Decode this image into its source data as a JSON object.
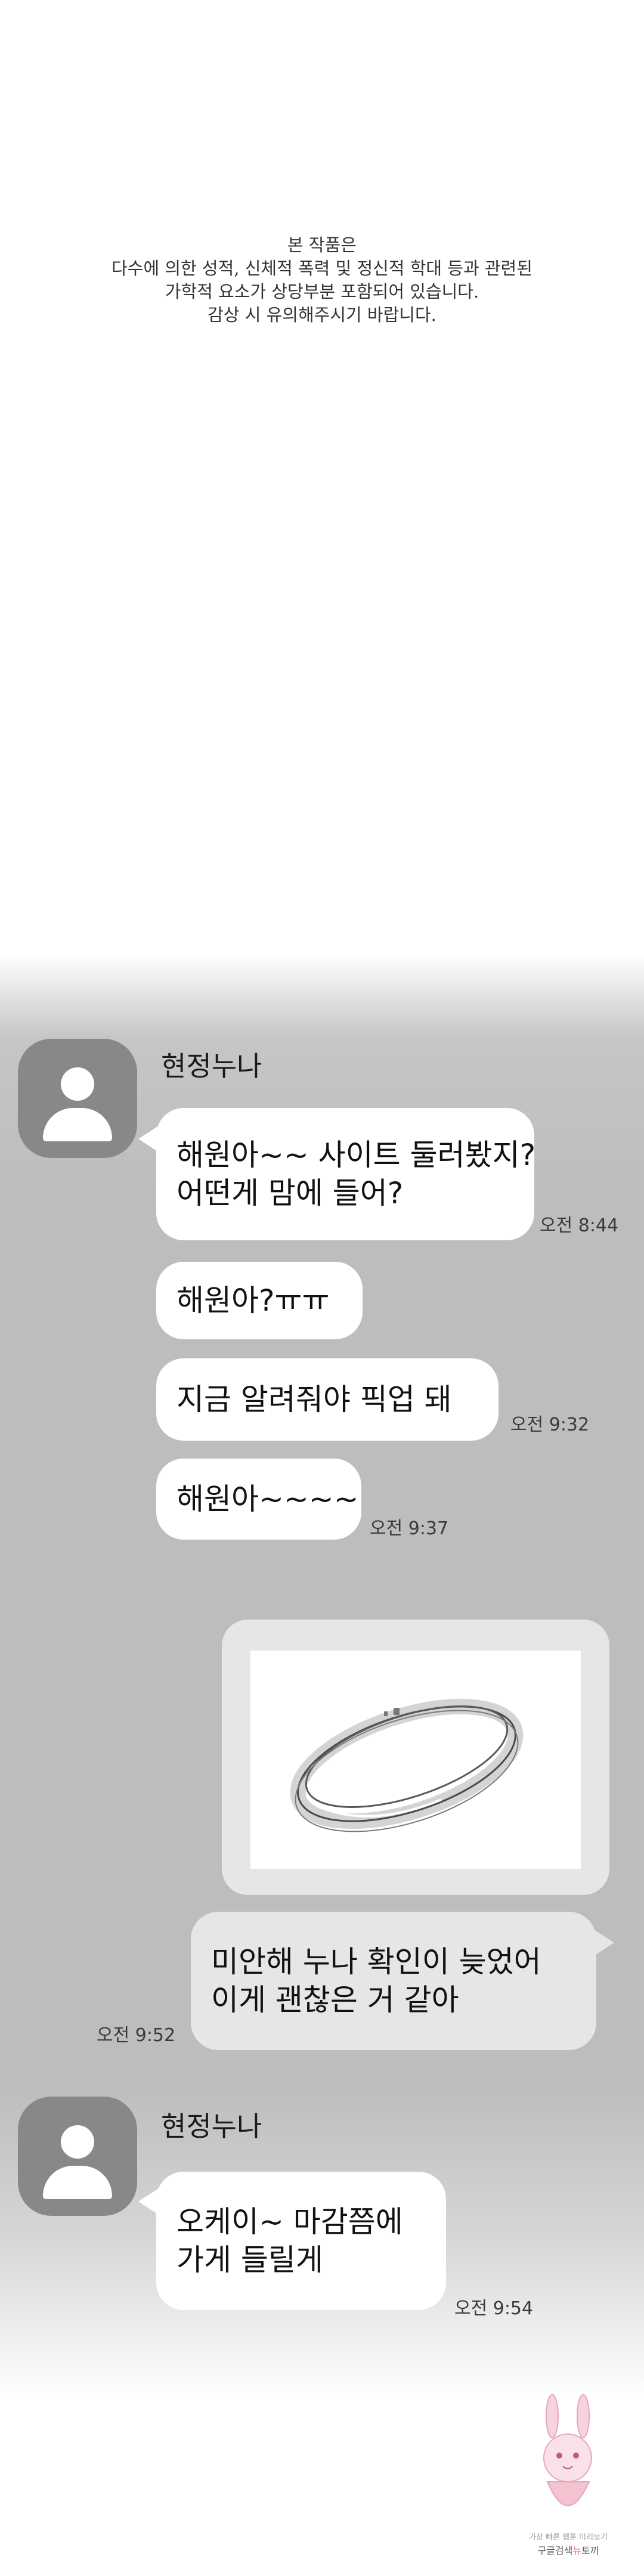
{
  "notice": {
    "lines": [
      "본 작품은",
      "다수에 의한 성적, 신체적 폭력 및 정신적 학대 등과 관련된",
      "가학적 요소가 상당부분 포함되어 있습니다.",
      "감상 시 유의해주시기 바랍니다."
    ]
  },
  "chat": {
    "group1": {
      "sender": "현정누나",
      "messages": [
        {
          "lines": [
            "해원아~~ 사이트 둘러봤지?",
            "어떤게 맘에 들어?"
          ],
          "time": "오전 8:44"
        },
        {
          "lines": [
            "해원아?ㅠㅠ"
          ],
          "time": ""
        },
        {
          "lines": [
            "지금 알려줘야 픽업 돼"
          ],
          "time": "오전 9:32"
        },
        {
          "lines": [
            "해원아~~~~"
          ],
          "time": "오전 9:37"
        }
      ]
    },
    "outgoing": {
      "image_alt": "bracelet",
      "message": {
        "lines": [
          "미안해 누나 확인이 늦었어",
          "이게 괜찮은 거 같아"
        ],
        "time": "오전 9:52"
      }
    },
    "group2": {
      "sender": "현정누나",
      "messages": [
        {
          "lines": [
            "오케이~ 마감쯤에",
            "가게 들릴게"
          ],
          "time": "오전 9:54"
        }
      ]
    }
  },
  "watermark": {
    "small_text": "가장 빠른 웹툰 미리보기",
    "brand_left": "구글검색",
    "brand_mid": "뉴",
    "brand_right": "토끼"
  },
  "colors": {
    "chat_background": "#bdbdbd",
    "incoming_bubble": "#ffffff",
    "outgoing_bubble": "#e6e6e6",
    "avatar": "#888888"
  }
}
